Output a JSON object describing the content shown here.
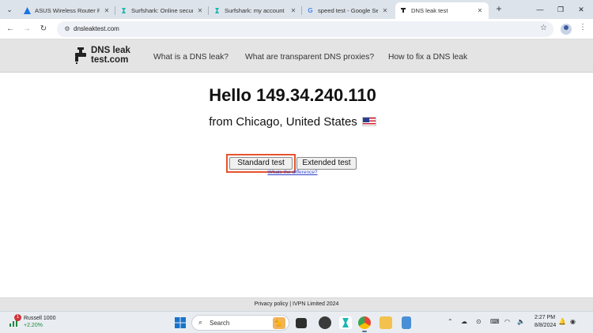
{
  "browser": {
    "tabs": [
      {
        "title": "ASUS Wireless Router RT",
        "active": false
      },
      {
        "title": "Surfshark: Online security",
        "active": false
      },
      {
        "title": "Surfshark: my account",
        "active": false
      },
      {
        "title": "speed test - Google Sear",
        "active": false
      },
      {
        "title": "DNS leak test",
        "active": true
      }
    ],
    "url": "dnsleaktest.com"
  },
  "site": {
    "logo_line1": "DNS leak",
    "logo_line2": "test.com",
    "nav": [
      "What is a DNS leak?",
      "What are transparent DNS proxies?",
      "How to fix a DNS leak"
    ]
  },
  "main": {
    "greeting": "Hello 149.34.240.110",
    "location": "from Chicago, United States",
    "standard_test": "Standard test",
    "extended_test": "Extended test",
    "difference_link": "Whats the difference?"
  },
  "footer": {
    "text": "Privacy policy | IVPN Limited 2024"
  },
  "taskbar": {
    "stock_badge": "1",
    "stock_name": "Russell 1000",
    "stock_change": "+2.20%",
    "search_label": "Search",
    "time": "2:27 PM",
    "date": "8/8/2024"
  },
  "colors": {
    "highlight": "#e5532d",
    "link": "#2d42c9",
    "header_bg": "#e4e4e4"
  }
}
